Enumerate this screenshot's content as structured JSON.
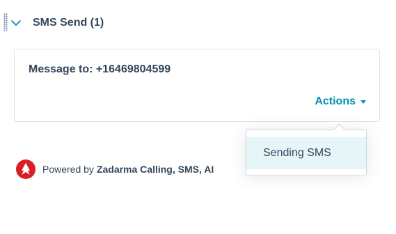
{
  "section": {
    "title": "SMS Send (1)",
    "expand_icon": "chevron-down-icon",
    "drag_icon": "drag-handle-icon"
  },
  "card": {
    "message": "Message to: +16469804599",
    "actions_label": "Actions",
    "actions_icon": "caret-down-icon"
  },
  "dropdown": {
    "items": [
      {
        "label": "Sending SMS"
      }
    ]
  },
  "footer": {
    "powered_by": "Powered by",
    "brand": "Zadarma Calling, SMS, AI",
    "logo_icon": "zadarma-logo-icon"
  },
  "colors": {
    "accent": "#0091ae",
    "text": "#33475b",
    "border": "#dfe3eb",
    "highlight": "#e5f5f8",
    "logo": "#d71f26"
  }
}
